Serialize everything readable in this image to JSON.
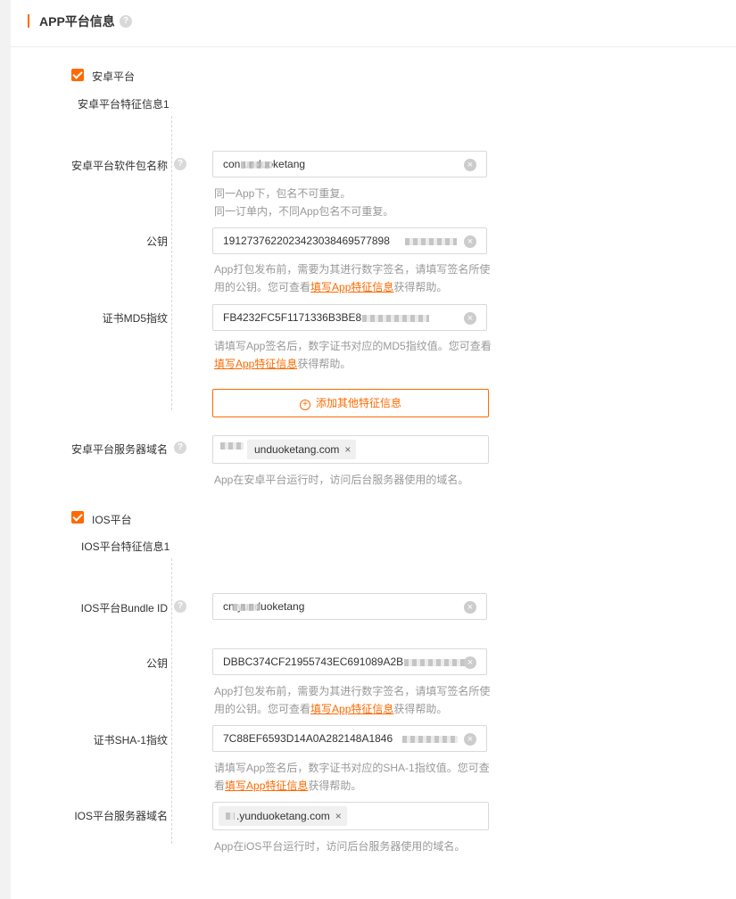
{
  "header": {
    "title": "APP平台信息",
    "help": "?"
  },
  "android": {
    "checkbox_label": "安卓平台",
    "feature_title": "安卓平台特征信息1",
    "package": {
      "label": "安卓平台软件包名称",
      "value": "con      unduoketang",
      "hint1": "同一App下，包名不可重复。",
      "hint2": "同一订单内，不同App包名不可重复。"
    },
    "pubkey": {
      "label": "公钥",
      "value": "19127376220234230384695778​98",
      "hint_pre": "App打包发布前，需要为其进行数字签名，请填写签名所使用的公钥。您可查看",
      "hint_link": "填写App特征信息",
      "hint_post": "获得帮助。"
    },
    "md5": {
      "label": "证书MD5指纹",
      "value": "FB4232FC5F1171336B3BE8",
      "hint_pre": "请填写App签名后，数字证书对应的MD5指纹值。您可查看",
      "hint_link": "填写App特征信息",
      "hint_post": "获得帮助。"
    },
    "add_button": "添加其他特征信息",
    "domain": {
      "label": "安卓平台服务器域名",
      "tag": "unduoketang.com",
      "tag_close": "×",
      "hint": "App在安卓平台运行时，访问后台服务器使用的域名。"
    }
  },
  "ios": {
    "checkbox_label": "IOS平台",
    "feature_title": "IOS平台特征信息1",
    "bundle": {
      "label": "IOS平台Bundle ID",
      "value": "cn       yunduoketang"
    },
    "pubkey": {
      "label": "公钥",
      "value": "DBBC374CF21955743EC691089A2B",
      "hint_pre": "App打包发布前，需要为其进行数字签名，请填写签名所使用的公钥。您可查看",
      "hint_link": "填写App特征信息",
      "hint_post": "获得帮助。"
    },
    "sha1": {
      "label": "证书SHA-1指纹",
      "value": "7C88EF6593D14A0A282148A1846",
      "hint_pre": "请填写App签名后，数字证书对应的SHA-1指纹值。您可查看",
      "hint_link": "填写App特征信息",
      "hint_post": "获得帮助。"
    },
    "domain": {
      "label": "IOS平台服务器域名",
      "tag": ".yunduoketang.com",
      "tag_close": "×",
      "hint": "App在iOS平台运行时，访问后台服务器使用的域名。"
    }
  },
  "clear_icon": "×",
  "colors": {
    "accent": "#ff6a00",
    "hint": "#999999"
  }
}
